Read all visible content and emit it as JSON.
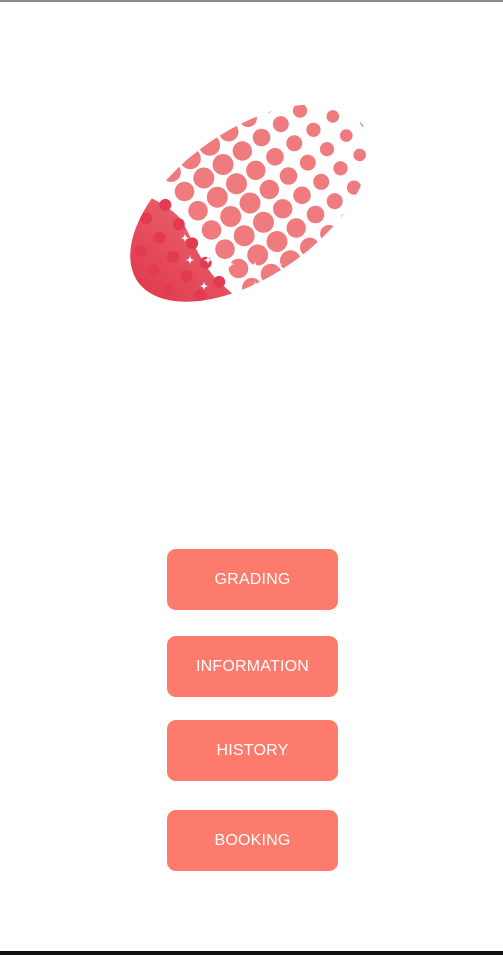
{
  "colors": {
    "button_background": "#fd7b6c",
    "button_text": "#ffffff",
    "logo_dark": "#e02c44",
    "logo_light": "#ef7e80"
  },
  "logo": {
    "icon": "halftone-oval-logo"
  },
  "menu": {
    "buttons": [
      {
        "label": "GRADING"
      },
      {
        "label": "INFORMATION"
      },
      {
        "label": "HISTORY"
      },
      {
        "label": "BOOKING"
      }
    ]
  }
}
